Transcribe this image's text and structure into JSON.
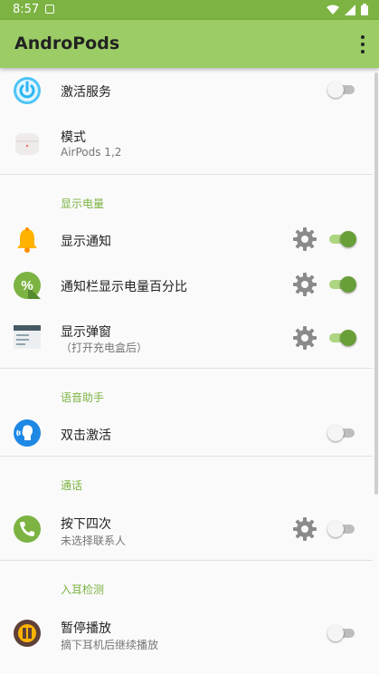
{
  "status_bar": {
    "time": "8:57"
  },
  "app_bar": {
    "title": "AndroPods"
  },
  "rows": {
    "activate_service": {
      "label": "激活服务",
      "switch_on": false
    },
    "mode": {
      "label": "模式",
      "value": "AirPods 1,2"
    },
    "show_notification": {
      "label": "显示通知",
      "switch_on": true
    },
    "status_bar_percent": {
      "label": "通知栏显示电量百分比",
      "switch_on": true
    },
    "show_popup": {
      "label": "显示弹窗",
      "sub": "（打开充电盒后）",
      "switch_on": true
    },
    "double_tap": {
      "label": "双击激活",
      "switch_on": false
    },
    "press_four": {
      "label": "按下四次",
      "sub": "未选择联系人",
      "switch_on": false
    },
    "pause_play": {
      "label": "暂停播放",
      "sub": "摘下耳机后继续播放",
      "switch_on": false
    }
  },
  "sections": {
    "battery": "显示电量",
    "assistant": "语音助手",
    "call": "通话",
    "ear_detection": "入耳检测"
  },
  "colors": {
    "accent": "#7cb342",
    "app_bar": "#9ccc65",
    "switch_on": "#689f38"
  }
}
